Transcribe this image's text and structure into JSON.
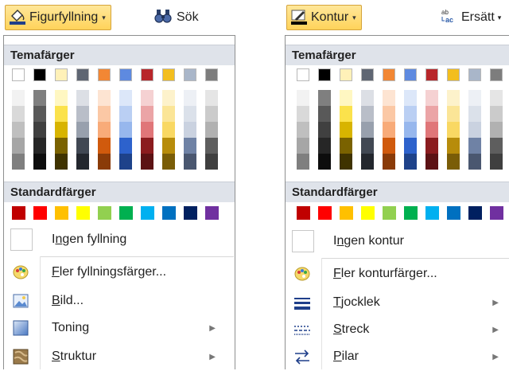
{
  "theme_colors": {
    "top": [
      "#ffffff",
      "#000000",
      "#fff1b8",
      "#5f6673",
      "#f28734",
      "#5e8ae0",
      "#b8262a",
      "#f3be1e",
      "#a9b6c9",
      "#7d7d7d"
    ],
    "shades": [
      [
        "#f2f2f2",
        "#d9d9d9",
        "#bfbfbf",
        "#a6a6a6",
        "#7f7f7f"
      ],
      [
        "#7f7f7f",
        "#595959",
        "#404040",
        "#262626",
        "#0d0d0d"
      ],
      [
        "#fff7c2",
        "#fbe24c",
        "#d8b400",
        "#7a6200",
        "#3f3300"
      ],
      [
        "#dcdfe5",
        "#b9bec8",
        "#98a0ad",
        "#414853",
        "#23272e"
      ],
      [
        "#fde4d2",
        "#fbc8a5",
        "#f8ab79",
        "#d05a0d",
        "#8a3b08"
      ],
      [
        "#dce7f9",
        "#bacff3",
        "#97b7ed",
        "#2d62cc",
        "#1e428a"
      ],
      [
        "#f5d1d2",
        "#eba4a6",
        "#e07679",
        "#8b1c1f",
        "#5c1214"
      ],
      [
        "#fdf2cb",
        "#fbe597",
        "#f9d863",
        "#b78c0b",
        "#7a5d07"
      ],
      [
        "#edf0f5",
        "#dbe1ea",
        "#cad2e0",
        "#6f82a5",
        "#4a5770"
      ],
      [
        "#e5e5e5",
        "#cbcbcb",
        "#b1b1b1",
        "#5e5e5e",
        "#3f3f3f"
      ]
    ]
  },
  "standard_colors": [
    "#c00000",
    "#ff0000",
    "#ffc000",
    "#ffff00",
    "#92d050",
    "#00b050",
    "#00b0f0",
    "#0070c0",
    "#002060",
    "#7030a0"
  ],
  "left": {
    "button_label": "Figurfyllning",
    "button_arrow": "▾",
    "search_label": "Sök",
    "theme_heading": "Temafärger",
    "standard_heading": "Standardfärger",
    "no_fill_label": "Ingen fyllning",
    "more_colors_label": "Fler fyllningsfärger...",
    "picture_label": "Bild...",
    "gradient_label": "Toning",
    "texture_label": "Struktur",
    "submenu_arrow": "▶"
  },
  "right": {
    "button_label": "Kontur",
    "button_arrow": "▾",
    "replace_label": "Ersätt",
    "replace_arrow": "▾",
    "theme_heading": "Temafärger",
    "standard_heading": "Standardfärger",
    "no_outline_label": "Ingen kontur",
    "more_colors_label": "Fler konturfärger...",
    "weight_label": "Tjocklek",
    "dashes_label": "Streck",
    "arrows_label": "Pilar",
    "submenu_arrow": "▶"
  }
}
